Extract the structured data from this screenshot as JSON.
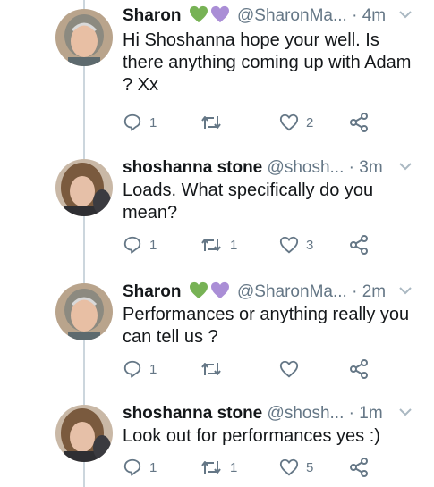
{
  "colors": {
    "heart_green": "#77b255",
    "heart_purple": "#aa8ed6",
    "thread_line": "#ccd6dd",
    "muted": "#657786",
    "text": "#14171a"
  },
  "tweets": [
    {
      "name": "Sharon",
      "has_hearts": true,
      "handle": "@SharonMa...",
      "time": "4m",
      "text": "Hi Shoshanna hope your well. Is there anything coming up with Adam ? Xx",
      "replies": "1",
      "retweets": "",
      "likes": "2",
      "avatar": "sharon"
    },
    {
      "name": "shoshanna stone",
      "has_hearts": false,
      "handle": "@shosh...",
      "time": "3m",
      "text": "Loads. What specifically do you mean?",
      "replies": "1",
      "retweets": "1",
      "likes": "3",
      "avatar": "shoshanna"
    },
    {
      "name": "Sharon",
      "has_hearts": true,
      "handle": "@SharonMa...",
      "time": "2m",
      "text": "Performances or anything really you can tell us ?",
      "replies": "1",
      "retweets": "",
      "likes": "",
      "avatar": "sharon"
    },
    {
      "name": "shoshanna stone",
      "has_hearts": false,
      "handle": "@shosh...",
      "time": "1m",
      "text": "Look out for performances yes :)",
      "replies": "1",
      "retweets": "1",
      "likes": "5",
      "avatar": "shoshanna"
    }
  ],
  "icons": {
    "reply": "reply-icon",
    "retweet": "retweet-icon",
    "like": "heart-icon",
    "share": "share-icon",
    "menu": "chevron-down-icon"
  }
}
